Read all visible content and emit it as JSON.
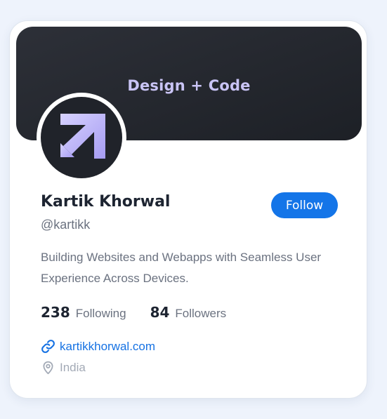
{
  "banner": {
    "title": "Design + Code"
  },
  "profile": {
    "name": "Kartik Khorwal",
    "handle": "@kartikk",
    "follow_label": "Follow",
    "bio": "Building Websites and Webapps with Seamless User Experience Across Devices."
  },
  "stats": {
    "following_count": "238",
    "following_label": "Following",
    "followers_count": "84",
    "followers_label": "Followers"
  },
  "details": {
    "website": "kartikkhorwal.com",
    "location": "India"
  },
  "icons": {
    "avatar_logo": "arrow-logo",
    "link": "link-icon",
    "location": "map-pin-icon"
  },
  "colors": {
    "accent": "#1475e8",
    "link": "#1672e3",
    "banner": "#22252c",
    "banner_text": "#c9c4f5",
    "muted": "#a3aab6"
  }
}
